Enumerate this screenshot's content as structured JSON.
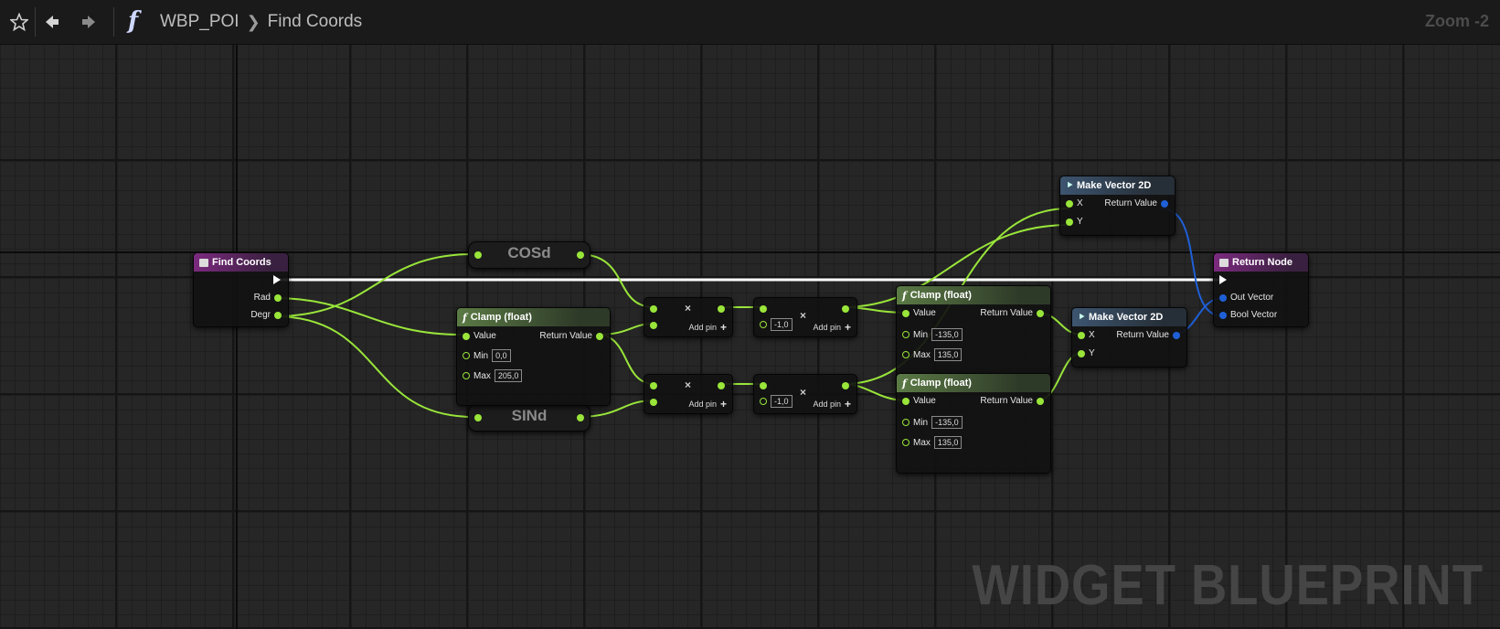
{
  "toolbar": {
    "breadcrumb_asset": "WBP_POI",
    "breadcrumb_function": "Find Coords",
    "zoom": "Zoom -2",
    "icons": [
      "star-icon",
      "back-arrow-icon",
      "forward-arrow-icon",
      "function-icon"
    ]
  },
  "watermark": "WIDGET BLUEPRINT",
  "nodes": {
    "entry": {
      "title": "Find Coords",
      "pin_rad": "Rad",
      "pin_degr": "Degr"
    },
    "cosd": {
      "title": "COSd"
    },
    "sind": {
      "title": "SINd"
    },
    "clamp_main": {
      "title": "Clamp (float)",
      "value": "Value",
      "return": "Return Value",
      "min_label": "Min",
      "min_value": "0,0",
      "max_label": "Max",
      "max_value": "205,0"
    },
    "mult_top": {
      "symbol": "×",
      "add_pin": "Add pin"
    },
    "mult_bottom": {
      "symbol": "×",
      "add_pin": "Add pin"
    },
    "mult_neg_top": {
      "symbol": "×",
      "input": "-1,0",
      "add_pin": "Add pin"
    },
    "mult_neg_bottom": {
      "symbol": "×",
      "input": "-1,0",
      "add_pin": "Add pin"
    },
    "clamp_top": {
      "title": "Clamp (float)",
      "value": "Value",
      "return": "Return Value",
      "min_label": "Min",
      "min_value": "-135,0",
      "max_label": "Max",
      "max_value": "135,0"
    },
    "clamp_bottom": {
      "title": "Clamp (float)",
      "value": "Value",
      "return": "Return Value",
      "min_label": "Min",
      "min_value": "-135,0",
      "max_label": "Max",
      "max_value": "135,0"
    },
    "vec_top": {
      "title": "Make Vector 2D",
      "x": "X",
      "y": "Y",
      "return": "Return Value"
    },
    "vec_bottom": {
      "title": "Make Vector 2D",
      "x": "X",
      "y": "Y",
      "return": "Return Value"
    },
    "return_node": {
      "title": "Return Node",
      "out_vector": "Out Vector",
      "bool_vector": "Bool Vector"
    }
  },
  "colors": {
    "float_wire": "#99e53a",
    "vector_wire": "#1f5fd6",
    "exec_wire": "#ffffff",
    "function_header": "#5b7a45",
    "entry_header": "#7b2a7e"
  }
}
